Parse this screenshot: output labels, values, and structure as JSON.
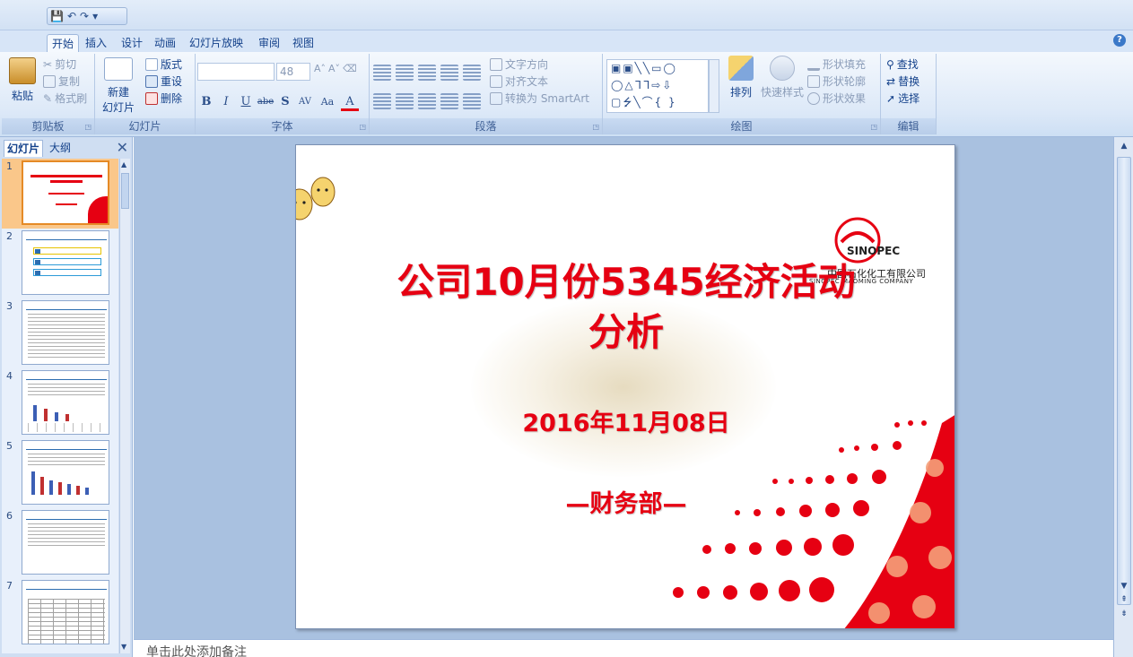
{
  "quick_access": {
    "save": "💾",
    "undo": "↶",
    "redo": "↷",
    "more": "▾"
  },
  "tabs": [
    "开始",
    "插入",
    "设计",
    "动画",
    "幻灯片放映",
    "审阅",
    "视图"
  ],
  "ribbon": {
    "clipboard": {
      "paste": "粘贴",
      "cut": "剪切",
      "copy": "复制",
      "format_painter": "格式刷",
      "label": "剪贴板"
    },
    "slides": {
      "new_slide_1": "新建",
      "new_slide_2": "幻灯片",
      "layout": "版式",
      "reset": "重设",
      "delete": "删除",
      "label": "幻灯片"
    },
    "font": {
      "font_size": "48",
      "label": "字体",
      "bold": "B",
      "italic": "I",
      "underline": "U",
      "strike": "abe",
      "shadow": "S",
      "spacing": "AV",
      "case": "Aa",
      "color": "A"
    },
    "paragraph": {
      "text_direction": "文字方向",
      "align_text": "对齐文本",
      "smartart": "转换为 SmartArt",
      "label": "段落"
    },
    "drawing": {
      "shapes_row1": "▣▣╲╲▭◯",
      "shapes_row2": "◯△ᒣᒣ⇨⇩",
      "shapes_row3": "▢⭍╲⌒{ }",
      "arrange": "排列",
      "quick_styles": "快速样式",
      "shape_fill": "形状填充",
      "shape_outline": "形状轮廓",
      "shape_effects": "形状效果",
      "label": "绘图"
    },
    "editing": {
      "find": "查找",
      "replace": "替换",
      "select": "选择",
      "label": "编辑"
    }
  },
  "left_panel": {
    "tab_slides": "幻灯片",
    "tab_outline": "大纲",
    "close": "✕"
  },
  "thumbnails": [
    {
      "num": "1"
    },
    {
      "num": "2"
    },
    {
      "num": "3"
    },
    {
      "num": "4"
    },
    {
      "num": "5"
    },
    {
      "num": "6"
    },
    {
      "num": "7"
    }
  ],
  "slide": {
    "title_line1": "公司10月份5345经济活动",
    "title_line2": "分析",
    "date": "2016年11月08日",
    "department": "—财务部—",
    "logo_cn": "中国石化化工有限公司",
    "logo_en": "SINOPEC   MAOMING   COMPANY",
    "logo_mark": "SINOPEC"
  },
  "notes_placeholder": "单击此处添加备注",
  "colors": {
    "accent_red": "#e60012",
    "ribbon_blue": "#d7e5f7",
    "selection_orange": "#fac78a"
  }
}
